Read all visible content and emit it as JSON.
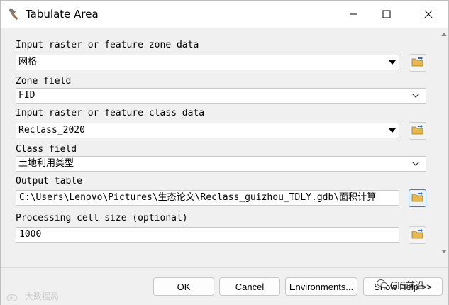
{
  "window": {
    "title": "Tabulate Area",
    "icon": "hammer-icon",
    "controls": [
      "minimize-icon",
      "maximize-icon",
      "close-icon"
    ]
  },
  "form": {
    "input_zone": {
      "label": "Input raster or feature zone data",
      "value": "网格"
    },
    "zone_field": {
      "label": "Zone field",
      "value": "FID"
    },
    "input_class": {
      "label": "Input raster or feature class data",
      "value": "Reclass_2020"
    },
    "class_field": {
      "label": "Class field",
      "value": "土地利用类型"
    },
    "output_table": {
      "label": "Output table",
      "value": "C:\\Users\\Lenovo\\Pictures\\生态论文\\Reclass_guizhou_TDLY.gdb\\面积计算"
    },
    "cell_size": {
      "label": "Processing cell size (optional)",
      "value": "1000"
    }
  },
  "buttons": {
    "ok": "OK",
    "cancel": "Cancel",
    "environments": "Environments...",
    "show_help": "Show Help >>"
  },
  "watermarks": {
    "left": "大数据局",
    "right": "GIS前沿"
  },
  "colors": {
    "window_bg": "#f0f0f0",
    "titlebar_bg": "#ffffff",
    "folder_icon": "#e8b84a",
    "folder_arrow": "#2f6fc4",
    "focus_border": "#3b78c6"
  }
}
